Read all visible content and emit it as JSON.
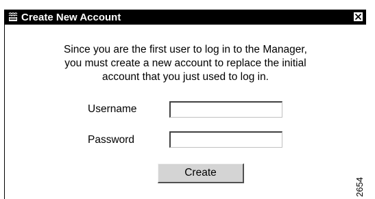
{
  "dialog": {
    "title": "Create New Account",
    "message_lines": [
      "Since you are the first user to log in to the Manager,",
      "you must create a new account to replace the initial",
      "account that you just used to log in."
    ],
    "username_label": "Username",
    "username_value": "",
    "password_label": "Password",
    "password_value": "",
    "create_label": "Create"
  },
  "figure_number": "2654",
  "colors": {
    "titlebar": "#000000",
    "titlebar_text": "#ffffff",
    "button_face": "#d4d4d4",
    "background": "#ffffff"
  },
  "icons": {
    "app": "application-window-icon",
    "close": "close-icon"
  }
}
